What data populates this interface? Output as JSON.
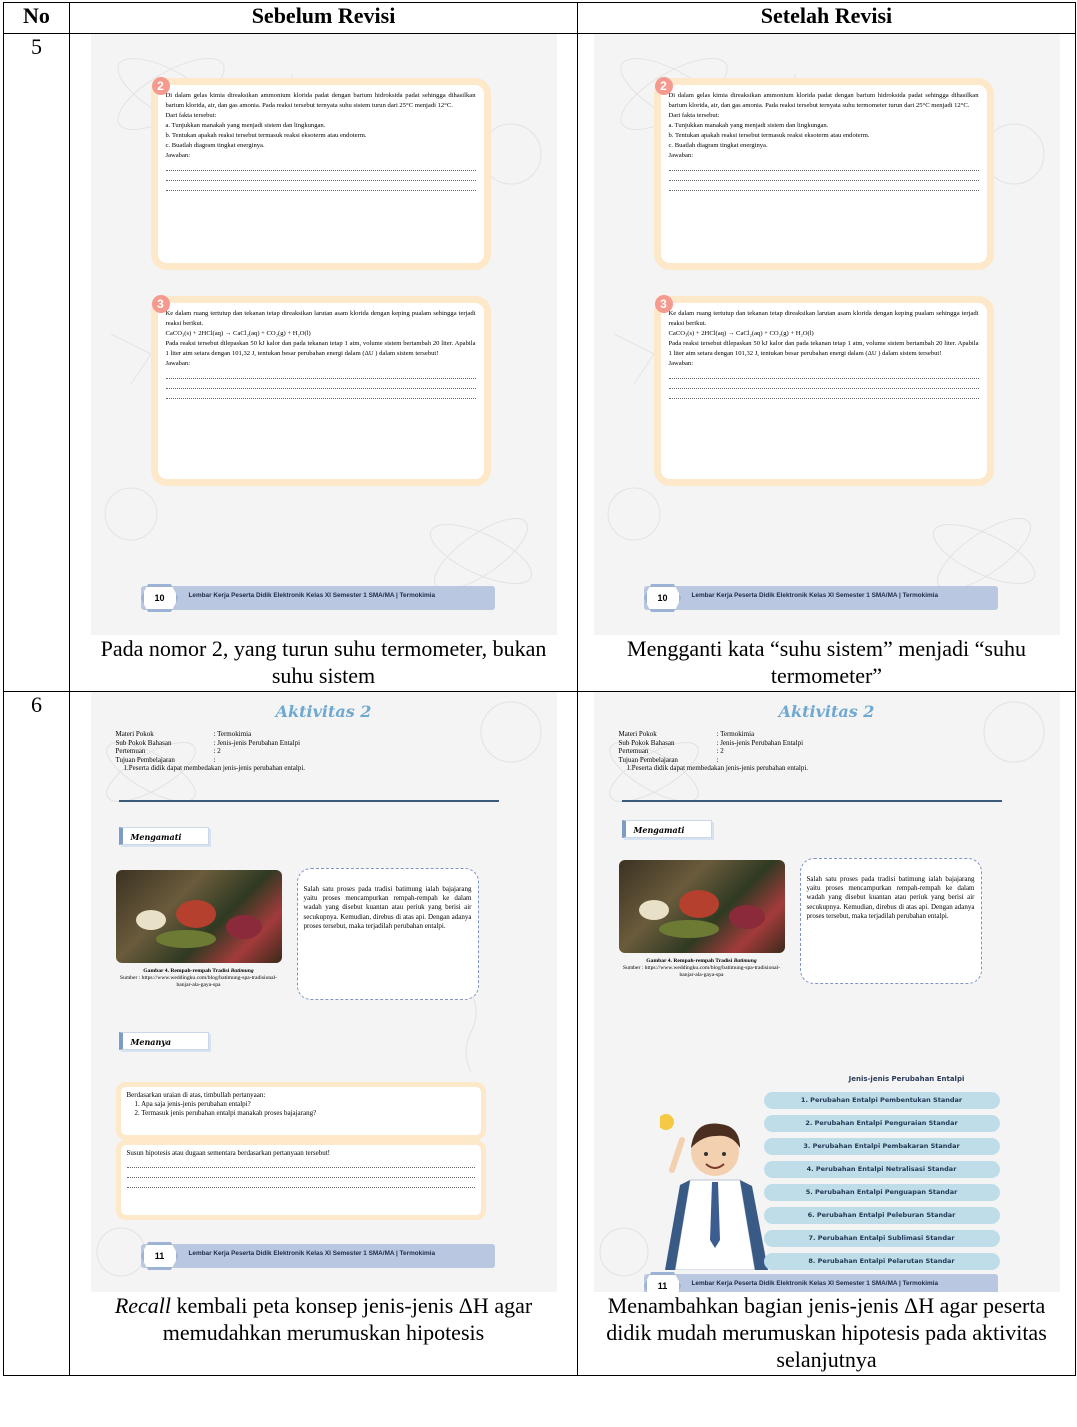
{
  "table": {
    "headers": {
      "no": "No",
      "before": "Sebelum Revisi",
      "after": "Setelah Revisi"
    },
    "rows": [
      {
        "no": "5",
        "caption_before": "Pada nomor 2, yang turun suhu termometer, bukan suhu sistem",
        "caption_after": "Mengganti kata “suhu sistem” menjadi “suhu termometer”"
      },
      {
        "no": "6",
        "caption_before_em": "Recall",
        "caption_before_rest": " kembali peta konsep jenis-jenis ΔH agar memudahkan merumuskan hipotesis",
        "caption_after": "Menambahkan bagian jenis-jenis ΔH agar peserta didik mudah merumuskan hipotesis pada aktivitas selanjutnya"
      }
    ]
  },
  "page10": {
    "q2": {
      "num": "2",
      "para_before": "Di dalam gelas kimia direaksikan ammonium klorida padat dengan barium hidroksida padat sehingga dihasilkan barium klorida, air, dan gas amonia. Pada reaksi tersebut ternyata suhu sistem turun dari 25°C menjadi 12°C.",
      "para_after": "Di dalam gelas kimia direaksikan ammonium klorida padat dengan barium hidroksida padat sehingga dihasilkan barium klorida, air, dan gas amonia. Pada reaksi tersebut ternyata suhu termometer turun dari 25°C menjadi 12°C.",
      "fakta": "Dari fakta tersebut:",
      "a": "a. Tunjukkan manakah yang menjadi sistem dan lingkungan.",
      "b": "b. Tentukan apakah reaksi tersebut termasuk reaksi eksoterm atau endoterm.",
      "c": "c. Buatlah diagram tingkat energinya.",
      "jawaban": "Jawaban:"
    },
    "q3": {
      "num": "3",
      "p1": "Ke dalam ruang tertutup dan tekanan tetap direaksikan larutan asam klorida dengan keping pualam sehingga terjadi reaksi berikut.",
      "eq": "CaCO₃(s) + 2HCl(aq) → CaCl₂(aq) + CO₂(g) + H₂O(l)",
      "p2": "Pada reaksi tersebut dilepaskan 50 kJ kalor dan pada tekanan tetap 1 atm, volume sistem bertambah 20 liter. Apabila 1 liter atm setara dengan 101,32 J, tentukan besar perubahan energi dalam (ΔU ) dalam sistem tersebut!",
      "jawaban": "Jawaban:"
    },
    "footer_num": "10",
    "footer_text": "Lembar Kerja Peserta Didik Elektronik Kelas XI Semester 1 SMA/MA | Termokimia"
  },
  "page11": {
    "title": "Aktivitas 2",
    "meta": [
      {
        "k": "Materi Pokok",
        "v": ": Termokimia"
      },
      {
        "k": "Sub Pokok Bahasan",
        "v": ": Jenis-jenis Perubahan Entalpi"
      },
      {
        "k": "Pertemuan",
        "v": ": 2"
      },
      {
        "k": "Tujuan Pembelajaran",
        "v": ":"
      }
    ],
    "tujuan": "1.Peserta didik dapat membedakan jenis-jenis perubahan entalpi.",
    "mengamati": "Mengamati",
    "bubble": "Salah satu proses pada tradisi batimung ialah bajajarang yaitu proses mencampurkan rempah-rempah ke dalam wadah yang disebut kuantan atau periuk yang berisi air secukupnya. Kemudian, direbus di atas api. Dengan adanya proses tersebut, maka terjadilah perubahan entalpi.",
    "gambar_label": "Gambar 4. Rempah-rempah Tradisi ",
    "gambar_em": "Batimung",
    "sumber": "Sumber : https://www.weddingku.com/blog/batimung-spa-tradisional-banjar-ala-gaya-spa",
    "menanya": "Menanya",
    "pertanyaan": "Berdasarkan uraian di atas, timbullah pertanyaan:",
    "q1": "1. Apa saja jenis-jenis perubahan entalpi?",
    "q2": "2. Termasuk jenis perubahan entalpi manakah proses bajajarang?",
    "hipotesis": "Susun hipotesis atau dugaan sementara berdasarkan pertanyaan tersebut!",
    "jenis_title": "Jenis-jenis Perubahan Entalpi",
    "jenis": [
      "1. Perubahan Entalpi Pembentukan Standar",
      "2. Perubahan Entalpi Penguraian Standar",
      "3. Perubahan Entalpi Pembakaran Standar",
      "4. Perubahan Entalpi Netralisasi Standar",
      "5. Perubahan Entalpi Penguapan Standar",
      "6. Perubahan Entalpi Peleburan Standar",
      "7. Perubahan Entalpi Sublimasi Standar",
      "8. Perubahan Entalpi Pelarutan Standar"
    ],
    "footer_num": "11",
    "footer_text": "Lembar Kerja Peserta Didik Elektronik Kelas XI Semester 1 SMA/MA | Termokimia"
  }
}
